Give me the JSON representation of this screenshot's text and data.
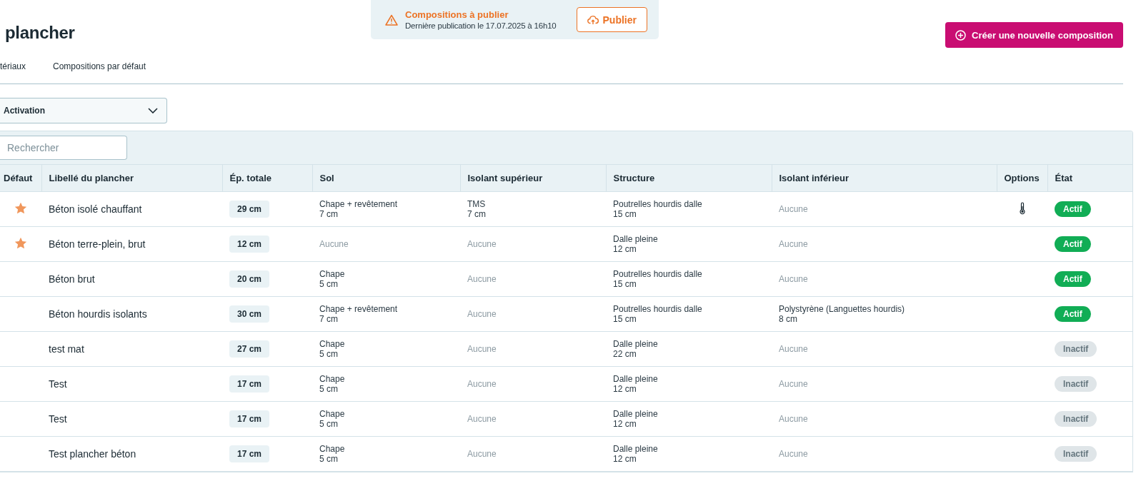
{
  "page": {
    "title": "plancher"
  },
  "publish_notice": {
    "title": "Compositions à publier",
    "subtitle": "Dernière publication le 17.07.2025 à 16h10",
    "button": "Publier"
  },
  "create_button": "Créer une nouvelle composition",
  "tabs": [
    {
      "label": "tériaux",
      "selected": false
    },
    {
      "label": "Compositions par défaut",
      "selected": false
    }
  ],
  "filter": {
    "value": "Activation"
  },
  "search": {
    "placeholder": "Rechercher"
  },
  "table": {
    "columns": [
      "Défaut",
      "Libellé du plancher",
      "Ép. totale",
      "Sol",
      "Isolant supérieur",
      "Structure",
      "Isolant inférieur",
      "Options",
      "État"
    ],
    "rows": [
      {
        "default": true,
        "name": "Béton isolé chauffant",
        "thickness": "29 cm",
        "sol": {
          "kind": "layer",
          "name": "Chape + revêtement",
          "thickness": "7 cm"
        },
        "upper": {
          "kind": "layer",
          "name": "TMS",
          "thickness": "7 cm"
        },
        "structure": {
          "kind": "layer",
          "name": "Poutrelles hourdis dalle",
          "thickness": "15 cm"
        },
        "lower": {
          "kind": "none",
          "name": "Aucune"
        },
        "heated": true,
        "status": {
          "label": "Actif",
          "active": true
        }
      },
      {
        "default": true,
        "name": "Béton terre-plein, brut",
        "thickness": "12 cm",
        "sol": {
          "kind": "none",
          "name": "Aucune"
        },
        "upper": {
          "kind": "none",
          "name": "Aucune"
        },
        "structure": {
          "kind": "layer",
          "name": "Dalle pleine",
          "thickness": "12 cm"
        },
        "lower": {
          "kind": "none",
          "name": "Aucune"
        },
        "heated": false,
        "status": {
          "label": "Actif",
          "active": true
        }
      },
      {
        "default": false,
        "name": "Béton brut",
        "thickness": "20 cm",
        "sol": {
          "kind": "layer",
          "name": "Chape",
          "thickness": "5 cm"
        },
        "upper": {
          "kind": "none",
          "name": "Aucune"
        },
        "structure": {
          "kind": "layer",
          "name": "Poutrelles hourdis dalle",
          "thickness": "15 cm"
        },
        "lower": {
          "kind": "none",
          "name": "Aucune"
        },
        "heated": false,
        "status": {
          "label": "Actif",
          "active": true
        }
      },
      {
        "default": false,
        "name": "Béton hourdis isolants",
        "thickness": "30 cm",
        "sol": {
          "kind": "layer",
          "name": "Chape + revêtement",
          "thickness": "7 cm"
        },
        "upper": {
          "kind": "none",
          "name": "Aucune"
        },
        "structure": {
          "kind": "layer",
          "name": "Poutrelles hourdis dalle",
          "thickness": "15 cm"
        },
        "lower": {
          "kind": "layer",
          "name": "Polystyrène (Languettes hourdis)",
          "thickness": "8 cm"
        },
        "heated": false,
        "status": {
          "label": "Actif",
          "active": true
        }
      },
      {
        "default": false,
        "name": "test mat",
        "thickness": "27 cm",
        "sol": {
          "kind": "layer",
          "name": "Chape",
          "thickness": "5 cm"
        },
        "upper": {
          "kind": "none",
          "name": "Aucune"
        },
        "structure": {
          "kind": "layer",
          "name": "Dalle pleine",
          "thickness": "22 cm"
        },
        "lower": {
          "kind": "none",
          "name": "Aucune"
        },
        "heated": false,
        "status": {
          "label": "Inactif",
          "active": false
        }
      },
      {
        "default": false,
        "name": "Test",
        "thickness": "17 cm",
        "sol": {
          "kind": "layer",
          "name": "Chape",
          "thickness": "5 cm"
        },
        "upper": {
          "kind": "none",
          "name": "Aucune"
        },
        "structure": {
          "kind": "layer",
          "name": "Dalle pleine",
          "thickness": "12 cm"
        },
        "lower": {
          "kind": "none",
          "name": "Aucune"
        },
        "heated": false,
        "status": {
          "label": "Inactif",
          "active": false
        }
      },
      {
        "default": false,
        "name": "Test",
        "thickness": "17 cm",
        "sol": {
          "kind": "layer",
          "name": "Chape",
          "thickness": "5 cm"
        },
        "upper": {
          "kind": "none",
          "name": "Aucune"
        },
        "structure": {
          "kind": "layer",
          "name": "Dalle pleine",
          "thickness": "12 cm"
        },
        "lower": {
          "kind": "none",
          "name": "Aucune"
        },
        "heated": false,
        "status": {
          "label": "Inactif",
          "active": false
        }
      },
      {
        "default": false,
        "name": "Test plancher béton",
        "thickness": "17 cm",
        "sol": {
          "kind": "layer",
          "name": "Chape",
          "thickness": "5 cm"
        },
        "upper": {
          "kind": "none",
          "name": "Aucune"
        },
        "structure": {
          "kind": "layer",
          "name": "Dalle pleine",
          "thickness": "12 cm"
        },
        "lower": {
          "kind": "none",
          "name": "Aucune"
        },
        "heated": false,
        "status": {
          "label": "Inactif",
          "active": false
        }
      }
    ]
  }
}
